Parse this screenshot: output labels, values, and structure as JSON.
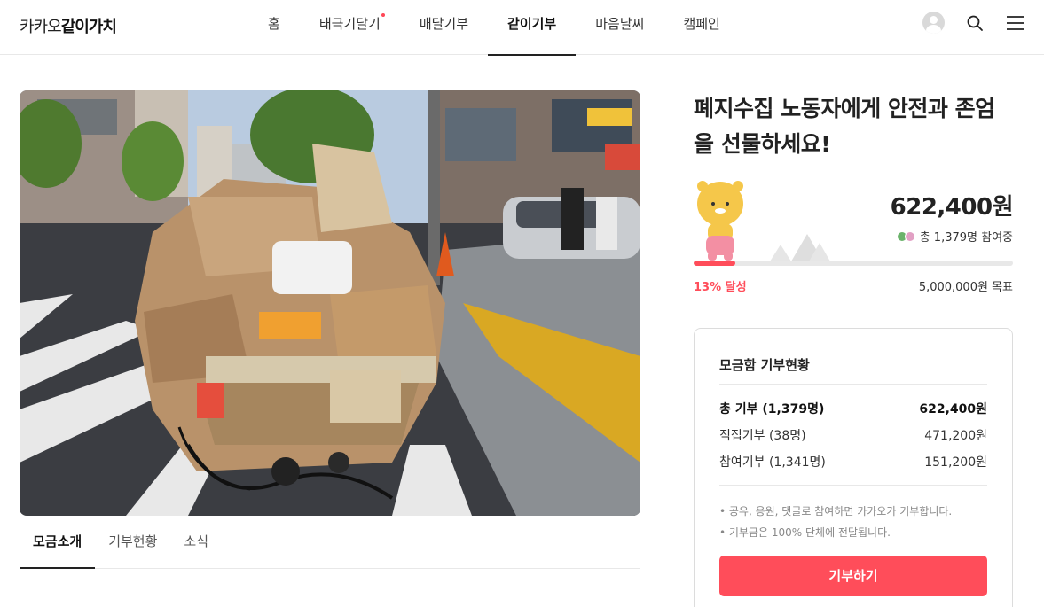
{
  "header": {
    "logo_light": "카카오",
    "logo_bold": "같이가치",
    "nav": [
      {
        "label": "홈",
        "active": false,
        "dot": false
      },
      {
        "label": "태극기달기",
        "active": false,
        "dot": true
      },
      {
        "label": "매달기부",
        "active": false,
        "dot": false
      },
      {
        "label": "같이기부",
        "active": true,
        "dot": false
      },
      {
        "label": "마음날씨",
        "active": false,
        "dot": false
      },
      {
        "label": "캠페인",
        "active": false,
        "dot": false
      }
    ],
    "icons": [
      "avatar",
      "search-icon",
      "menu-icon"
    ]
  },
  "tabs": [
    {
      "label": "모금소개",
      "active": true
    },
    {
      "label": "기부현황",
      "active": false
    },
    {
      "label": "소식",
      "active": false
    }
  ],
  "campaign": {
    "title": "폐지수집 노동자에게 안전과 존엄을 선물하세요!",
    "amount": "622,400원",
    "participants": "총 1,379명 참여중",
    "progress_percent": 13,
    "progress_label": "13% 달성",
    "goal_label": "5,000,000원 목표"
  },
  "donation_status": {
    "title": "모금함 기부현황",
    "rows": [
      {
        "label": "총 기부 (1,379명)",
        "value": "622,400원",
        "total": true
      },
      {
        "label": "직접기부 (38명)",
        "value": "471,200원",
        "total": false
      },
      {
        "label": "참여기부 (1,341명)",
        "value": "151,200원",
        "total": false
      }
    ],
    "notes": [
      "• 공유, 응원, 댓글로 참여하면 카카오가 기부합니다.",
      "• 기부금은 100% 단체에 전달됩니다."
    ],
    "button_label": "기부하기"
  },
  "colors": {
    "accent": "#ff4d5a",
    "nav_dot": "#ff4757"
  }
}
